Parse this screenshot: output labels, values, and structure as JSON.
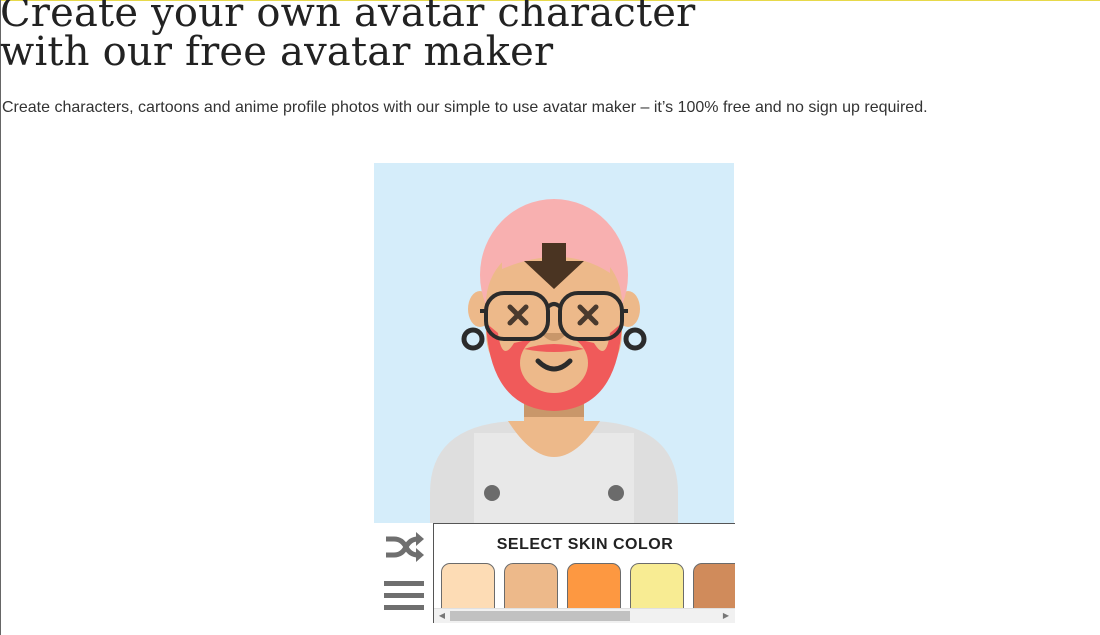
{
  "page": {
    "heading": "Create your own avatar character with our free avatar maker",
    "subtext": "Create characters, cartoons and anime profile photos with our simple to use avatar maker – it’s 100% free and no sign up required."
  },
  "toolbar": {
    "shuffle_icon": "shuffle-icon",
    "menu_icon": "hamburger-menu-icon"
  },
  "panel": {
    "title": "SELECT SKIN COLOR",
    "swatches": [
      "#fddcb5",
      "#edb98a",
      "#fd9841",
      "#f8ec93",
      "#d08b5b"
    ]
  },
  "colors": {
    "background": "#d5edfa",
    "hair": "#f8b0b0",
    "beard": "#f05a5a",
    "skin": "#edb98a",
    "shirt": "#dedede"
  }
}
